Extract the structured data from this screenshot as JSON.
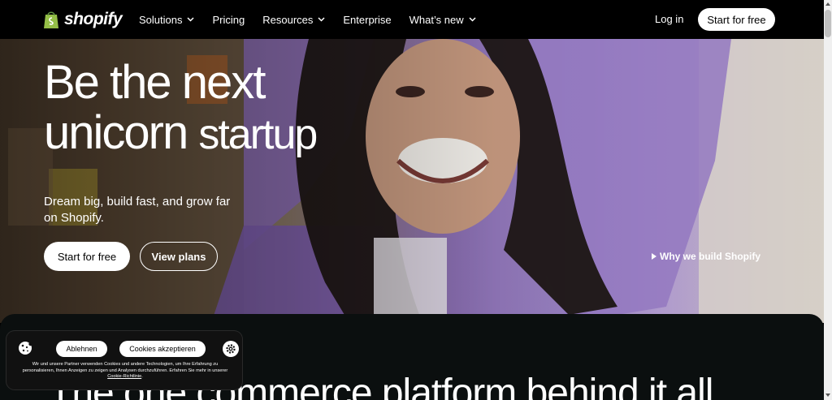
{
  "nav": {
    "brand": "shopify",
    "items": [
      {
        "label": "Solutions",
        "dropdown": true
      },
      {
        "label": "Pricing",
        "dropdown": false
      },
      {
        "label": "Resources",
        "dropdown": true
      },
      {
        "label": "Enterprise",
        "dropdown": false
      },
      {
        "label": "What’s new",
        "dropdown": true
      }
    ],
    "login": "Log in",
    "cta": "Start for free"
  },
  "hero": {
    "title_line1": "Be the next",
    "title_line2a": "unicorn",
    "title_line2b": "startup",
    "subtitle": "Dream big, build fast, and grow far on Shopify.",
    "primary_button": "Start for free",
    "secondary_button": "View plans",
    "video_link": "Why we build Shopify"
  },
  "section": {
    "title": "The one commerce platform behind it all"
  },
  "cookie_banner": {
    "reject": "Ablehnen",
    "accept": "Cookies akzeptieren",
    "text": "Wir und unsere Partner verwenden Cookies und andere Technologien, um Ihre Erfahrung zu personalisieren, Ihnen Anzeigen zu zeigen und Analysen durchzuführen. Erfahren Sie mehr in unserer",
    "link": "Cookie-Richtlinie",
    "link_suffix": "."
  },
  "colors": {
    "nav_bg": "#000000",
    "button_bg": "#ffffff",
    "shopify_green": "#95bf47",
    "dark_section": "#0b0f0f"
  }
}
